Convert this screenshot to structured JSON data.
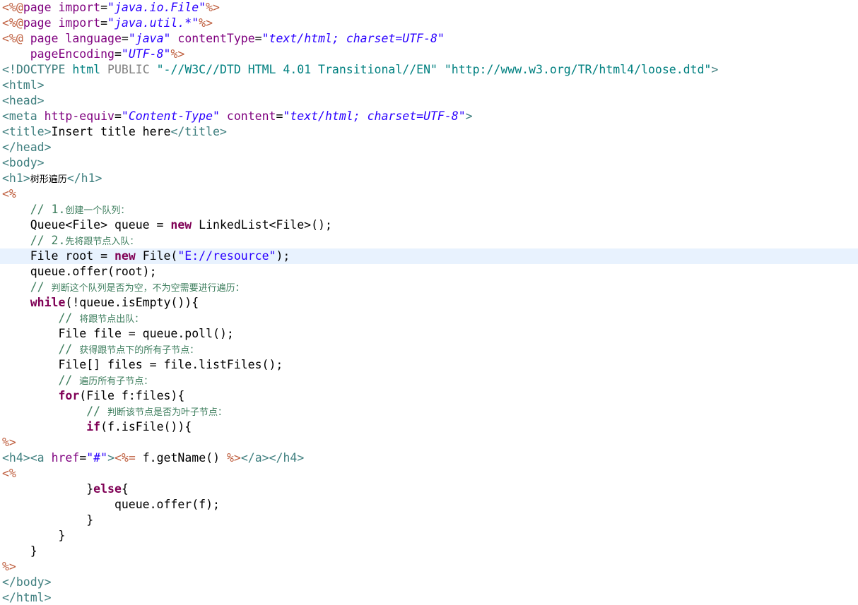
{
  "editor": {
    "current_line": 16,
    "colors": {
      "tag": "#3f7f7f",
      "attribute": "#7f007f",
      "string": "#2a00ff",
      "jsp_delimiter": "#bf5f3f",
      "keyword": "#7f0055",
      "comment": "#3f7f5f",
      "text": "#000000",
      "current_line_highlight": "#e8f2fe"
    },
    "lines": [
      [
        [
          "jsp",
          "<%@"
        ],
        [
          "attr",
          "page "
        ],
        [
          "attr",
          "import"
        ],
        [
          "txt",
          "="
        ],
        [
          "str",
          "\"java.io.File\""
        ],
        [
          "jsp",
          "%>"
        ]
      ],
      [
        [
          "jsp",
          "<%@"
        ],
        [
          "attr",
          "page "
        ],
        [
          "attr",
          "import"
        ],
        [
          "txt",
          "="
        ],
        [
          "str",
          "\"java.util.*\""
        ],
        [
          "jsp",
          "%>"
        ]
      ],
      [
        [
          "jsp",
          "<%@ "
        ],
        [
          "attr",
          "page "
        ],
        [
          "attr",
          "language"
        ],
        [
          "txt",
          "="
        ],
        [
          "str",
          "\"java\""
        ],
        [
          "txt",
          " "
        ],
        [
          "attr",
          "contentType"
        ],
        [
          "txt",
          "="
        ],
        [
          "str",
          "\"text/html; charset=UTF-8\""
        ]
      ],
      [
        [
          "txt",
          "    "
        ],
        [
          "attr",
          "pageEncoding"
        ],
        [
          "txt",
          "="
        ],
        [
          "str",
          "\"UTF-8\""
        ],
        [
          "jsp",
          "%>"
        ]
      ],
      [
        [
          "tag",
          "<!DOCTYPE "
        ],
        [
          "doc",
          "html"
        ],
        [
          "txt",
          " "
        ],
        [
          "docg",
          "PUBLIC"
        ],
        [
          "txt",
          " "
        ],
        [
          "doc",
          "\"-//W3C//DTD HTML 4.01 Transitional//EN\""
        ],
        [
          "txt",
          " "
        ],
        [
          "doc",
          "\"http://www.w3.org/TR/html4/loose.dtd\""
        ],
        [
          "tag",
          ">"
        ]
      ],
      [
        [
          "tag",
          "<html>"
        ]
      ],
      [
        [
          "tag",
          "<head>"
        ]
      ],
      [
        [
          "tag",
          "<meta "
        ],
        [
          "attr",
          "http-equiv"
        ],
        [
          "txt",
          "="
        ],
        [
          "str",
          "\"Content-Type\""
        ],
        [
          "txt",
          " "
        ],
        [
          "attr",
          "content"
        ],
        [
          "txt",
          "="
        ],
        [
          "str",
          "\"text/html; charset=UTF-8\""
        ],
        [
          "tag",
          ">"
        ]
      ],
      [
        [
          "tag",
          "<title>"
        ],
        [
          "txt",
          "Insert title here"
        ],
        [
          "tag",
          "</title>"
        ]
      ],
      [
        [
          "tag",
          "</head>"
        ]
      ],
      [
        [
          "tag",
          "<body>"
        ]
      ],
      [
        [
          "tag",
          "<h1>"
        ],
        [
          "txt cjk",
          "树形遍历"
        ],
        [
          "tag",
          "</h1>"
        ]
      ],
      [
        [
          "jsp",
          "<%"
        ]
      ],
      [
        [
          "txt",
          "    "
        ],
        [
          "cmt",
          "// 1."
        ],
        [
          "cmt cjk",
          "创建一个队列："
        ]
      ],
      [
        [
          "txt",
          "    Queue<File> queue = "
        ],
        [
          "kw",
          "new"
        ],
        [
          "txt",
          " LinkedList<File>();"
        ]
      ],
      [
        [
          "txt",
          "    "
        ],
        [
          "cmt",
          "// 2."
        ],
        [
          "cmt cjk",
          "先将跟节点入队："
        ]
      ],
      [
        [
          "txt",
          "    File root = "
        ],
        [
          "kw",
          "new"
        ],
        [
          "txt",
          " File("
        ],
        [
          "sstr",
          "\"E://resource\""
        ],
        [
          "txt",
          ");"
        ]
      ],
      [
        [
          "txt",
          "    queue.offer(root);"
        ]
      ],
      [
        [
          "txt",
          "    "
        ],
        [
          "cmt",
          "// "
        ],
        [
          "cmt cjk",
          "判断这个队列是否为空，不为空需要进行遍历："
        ]
      ],
      [
        [
          "txt",
          "    "
        ],
        [
          "kw",
          "while"
        ],
        [
          "txt",
          "(!queue.isEmpty()){"
        ]
      ],
      [
        [
          "txt",
          "        "
        ],
        [
          "cmt",
          "// "
        ],
        [
          "cmt cjk",
          "将跟节点出队："
        ]
      ],
      [
        [
          "txt",
          "        File file = queue.poll();"
        ]
      ],
      [
        [
          "txt",
          "        "
        ],
        [
          "cmt",
          "// "
        ],
        [
          "cmt cjk",
          "获得跟节点下的所有子节点："
        ]
      ],
      [
        [
          "txt",
          "        File[] files = file.listFiles();"
        ]
      ],
      [
        [
          "txt",
          "        "
        ],
        [
          "cmt",
          "// "
        ],
        [
          "cmt cjk",
          "遍历所有子节点："
        ]
      ],
      [
        [
          "txt",
          "        "
        ],
        [
          "kw",
          "for"
        ],
        [
          "txt",
          "(File f:files){"
        ]
      ],
      [
        [
          "txt",
          "            "
        ],
        [
          "cmt",
          "// "
        ],
        [
          "cmt cjk",
          "判断该节点是否为叶子节点："
        ]
      ],
      [
        [
          "txt",
          "            "
        ],
        [
          "kw",
          "if"
        ],
        [
          "txt",
          "(f.isFile()){"
        ]
      ],
      [
        [
          "jsp",
          "%>"
        ]
      ],
      [
        [
          "tag",
          "<h4>"
        ],
        [
          "tag",
          "<a "
        ],
        [
          "attr",
          "href"
        ],
        [
          "txt",
          "="
        ],
        [
          "str",
          "\"#\""
        ],
        [
          "tag",
          ">"
        ],
        [
          "jsp",
          "<%="
        ],
        [
          "txt",
          " f.getName() "
        ],
        [
          "jsp",
          "%>"
        ],
        [
          "tag",
          "</a>"
        ],
        [
          "tag",
          "</h4>"
        ]
      ],
      [
        [
          "jsp",
          "<%"
        ]
      ],
      [
        [
          "txt",
          "            }"
        ],
        [
          "kw",
          "else"
        ],
        [
          "txt",
          "{"
        ]
      ],
      [
        [
          "txt",
          "                queue.offer(f);"
        ]
      ],
      [
        [
          "txt",
          "            }"
        ]
      ],
      [
        [
          "txt",
          "        }"
        ]
      ],
      [
        [
          "txt",
          "    }"
        ]
      ],
      [
        [
          "jsp",
          "%>"
        ]
      ],
      [
        [
          "tag",
          "</body>"
        ]
      ],
      [
        [
          "tag",
          "</html>"
        ]
      ]
    ]
  }
}
